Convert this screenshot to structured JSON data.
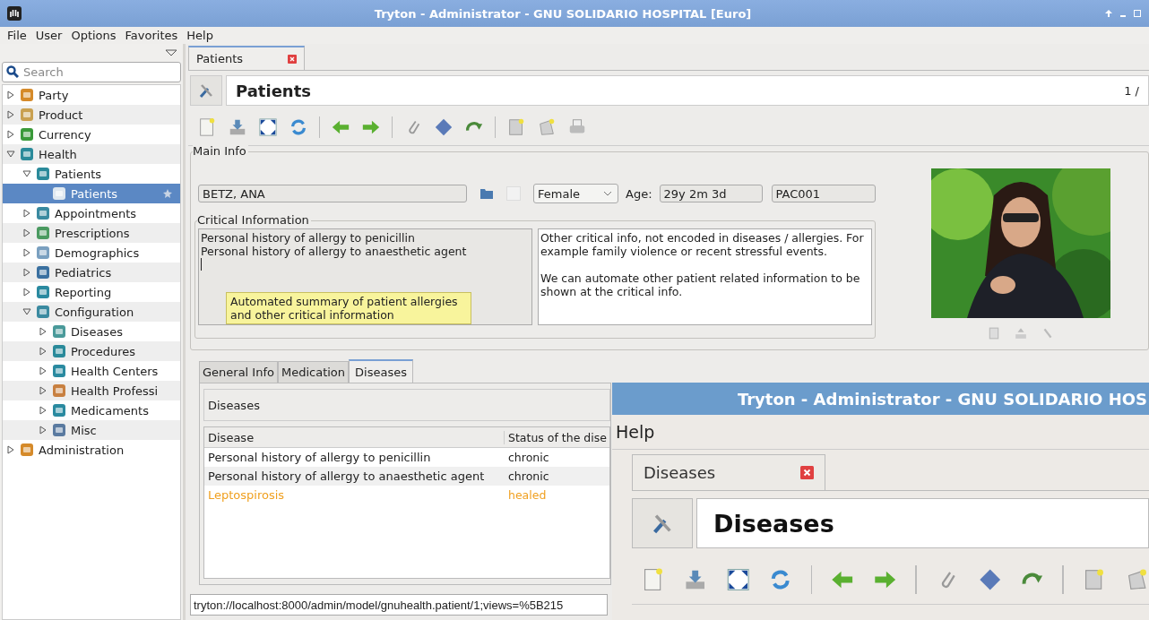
{
  "window": {
    "title": "Tryton - Administrator - GNU SOLIDARIO HOSPITAL [Euro]"
  },
  "menu": [
    {
      "label": "File"
    },
    {
      "label": "User"
    },
    {
      "label": "Options"
    },
    {
      "label": "Favorites"
    },
    {
      "label": "Help"
    }
  ],
  "sidebar": {
    "search": {
      "placeholder": "Search"
    },
    "items": [
      {
        "label": "Party",
        "expanded": false,
        "selected": false
      },
      {
        "label": "Product",
        "expanded": false,
        "selected": false
      },
      {
        "label": "Currency",
        "expanded": false,
        "selected": false
      },
      {
        "label": "Health",
        "expanded": true,
        "selected": false,
        "children": [
          {
            "label": "Patients",
            "expanded": true,
            "selected": false,
            "children": [
              {
                "label": "Patients",
                "selected": true
              }
            ]
          },
          {
            "label": "Appointments",
            "expanded": false,
            "selected": false
          },
          {
            "label": "Prescriptions",
            "expanded": false,
            "selected": false
          },
          {
            "label": "Demographics",
            "expanded": false,
            "selected": false
          },
          {
            "label": "Pediatrics",
            "expanded": false,
            "selected": false
          },
          {
            "label": "Reporting",
            "expanded": false,
            "selected": false
          },
          {
            "label": "Configuration",
            "expanded": true,
            "selected": false,
            "children": [
              {
                "label": "Diseases",
                "expanded": false,
                "selected": false
              },
              {
                "label": "Procedures",
                "expanded": false,
                "selected": false
              },
              {
                "label": "Health Centers",
                "expanded": false,
                "selected": false
              },
              {
                "label": "Health Professi",
                "expanded": false,
                "selected": false
              },
              {
                "label": "Medicaments",
                "expanded": false,
                "selected": false
              },
              {
                "label": "Misc",
                "expanded": false,
                "selected": false
              }
            ]
          }
        ]
      },
      {
        "label": "Administration",
        "expanded": false,
        "selected": false
      }
    ]
  },
  "tabs": [
    {
      "label": "Patients",
      "selected": true
    }
  ],
  "form": {
    "title": "Patients",
    "record_position": "1 /",
    "main_info": {
      "legend": "Main Info",
      "name": "BETZ, ANA",
      "gender": "Female",
      "age_label": "Age:",
      "age": "29y 2m 3d",
      "patient_id": "PAC001",
      "flag_checked": false
    },
    "critical": {
      "legend": "Critical Information",
      "summary_lines": [
        "Personal history of allergy to penicillin",
        "Personal history of allergy to anaesthetic agent"
      ],
      "tooltip": "Automated summary of patient allergies and other critical information",
      "notes": [
        "Other critical info, not encoded in diseases / allergies. For example family violence or recent stressful events.",
        "We can automate other patient related information to be shown at the critical info."
      ]
    },
    "notebook": {
      "tabs": [
        {
          "label": "General Info",
          "selected": false
        },
        {
          "label": "Medication",
          "selected": false
        },
        {
          "label": "Diseases",
          "selected": true
        }
      ],
      "section_label": "Diseases",
      "columns": [
        "Disease",
        "Status of the dise"
      ],
      "rows": [
        {
          "cells": [
            "Personal history of allergy to penicillin",
            "chronic"
          ],
          "color": "#222222"
        },
        {
          "cells": [
            "Personal history of allergy to anaesthetic agent",
            "chronic"
          ],
          "color": "#222222"
        },
        {
          "cells": [
            "Leptospirosis",
            "healed"
          ],
          "color": "#f0a020"
        }
      ]
    }
  },
  "url": "tryton://localhost:8000/admin/model/gnuhealth.patient/1;views=%5B215",
  "second_window": {
    "title": "Tryton - Administrator - GNU SOLIDARIO HOS",
    "menu": [
      {
        "label": "Help"
      }
    ],
    "tabs": [
      {
        "label": "Diseases",
        "selected": true
      }
    ],
    "form_title": "Diseases"
  }
}
